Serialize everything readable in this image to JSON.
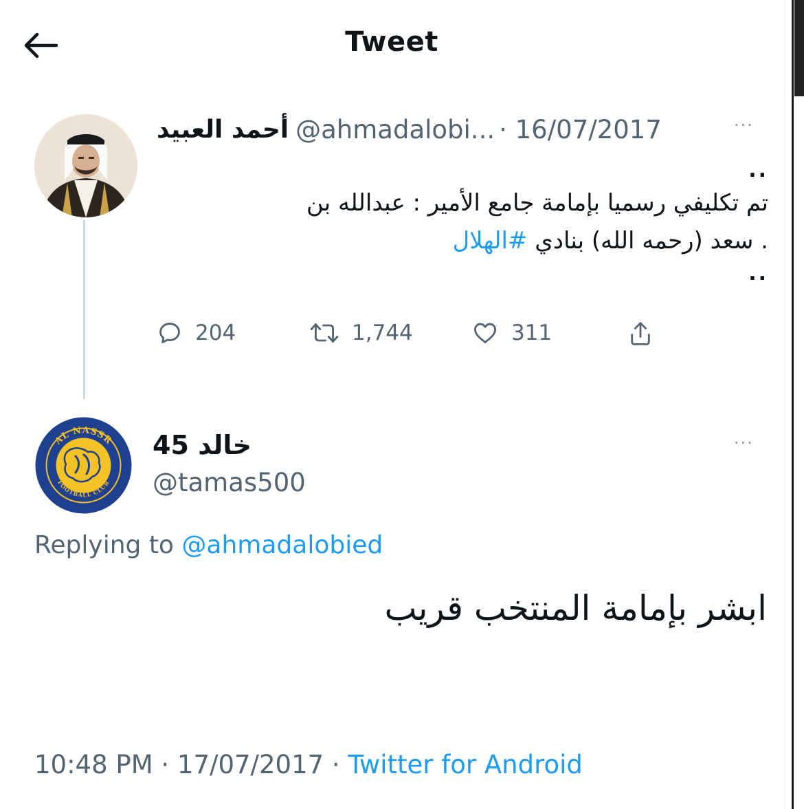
{
  "header": {
    "title": "Tweet",
    "back_icon": "arrow-left-icon"
  },
  "original_tweet": {
    "author_name": "أحمد العبيد",
    "handle": "@ahmadalobi...",
    "date": "· 16/07/2017",
    "more": "···",
    "line_dots_top": "..",
    "text_line1": "تم تكليفي رسميا بإمامة جامع الأمير : عبدالله بن",
    "text_line2": ". سعد (رحمه الله) بنادي",
    "hashtag": "#الهلال",
    "line_dots_bottom": "..",
    "stats": {
      "replies": "204",
      "retweets": "1,744",
      "likes": "311"
    }
  },
  "reply_tweet": {
    "author_name": "خالد 45",
    "handle": "@tamas500",
    "more": "···",
    "replying_prefix": "Replying to",
    "replying_to": "@ahmadalobied",
    "text": "ابشر بإمامة المنتخب قريب",
    "time": "10:48 PM · 17/07/2017 ·",
    "source": "Twitter for Android",
    "avatar_text_top": "AL NASSR",
    "avatar_text_bottom": "FOOTBALL CLUB"
  },
  "colors": {
    "link": "#1d9bf0",
    "secondary_text": "#536471",
    "nassr_yellow": "#f4c126",
    "nassr_blue": "#1f3f8f"
  }
}
